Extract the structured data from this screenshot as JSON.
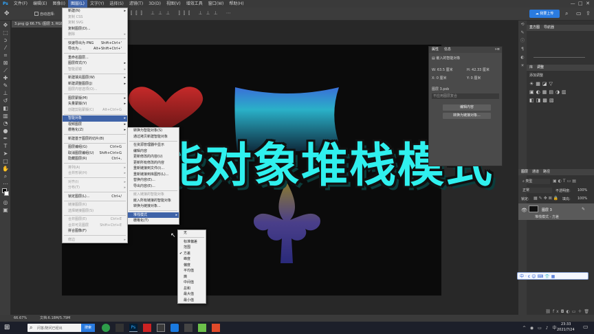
{
  "menubar": {
    "items": [
      "文件(F)",
      "编辑(E)",
      "图像(I)",
      "图层(L)",
      "文字(Y)",
      "选择(S)",
      "滤镜(T)",
      "3D(D)",
      "视图(V)",
      "增效工具",
      "窗口(W)",
      "帮助(H)"
    ]
  },
  "options": {
    "auto_select": "自动选择:",
    "upload_btn": "我要上传"
  },
  "doc_tab": {
    "title": "3.png @ 66.7% (图层 3, RGB/8#) ×"
  },
  "layer_menu": {
    "items": [
      {
        "label": "新建(N)",
        "arrow": true
      },
      {
        "label": "复制 CSS",
        "disabled": true
      },
      {
        "label": "复制 SVG",
        "disabled": true
      },
      {
        "label": "复制图层(D)..."
      },
      {
        "label": "删除",
        "arrow": true,
        "disabled": true
      },
      {
        "sep": true
      },
      {
        "label": "快速导出为 PNG",
        "shortcut": "Shift+Ctrl+'"
      },
      {
        "label": "导出为...",
        "shortcut": "Alt+Shift+Ctrl+'"
      },
      {
        "sep": true
      },
      {
        "label": "重命名图层..."
      },
      {
        "label": "图层样式(Y)",
        "arrow": true
      },
      {
        "label": "智能滤镜",
        "arrow": true,
        "disabled": true
      },
      {
        "sep": true
      },
      {
        "label": "新建填充图层(W)",
        "arrow": true
      },
      {
        "label": "新建调整图层(J)",
        "arrow": true
      },
      {
        "label": "图层内容选项(O)...",
        "disabled": true
      },
      {
        "sep": true
      },
      {
        "label": "图层蒙版(M)",
        "arrow": true
      },
      {
        "label": "矢量蒙版(V)",
        "arrow": true
      },
      {
        "label": "创建剪贴蒙版(C)",
        "shortcut": "Alt+Ctrl+G",
        "disabled": true
      },
      {
        "sep": true
      },
      {
        "label": "智能对象",
        "arrow": true,
        "highlight": true
      },
      {
        "label": "视频图层",
        "arrow": true
      },
      {
        "label": "栅格化(Z)",
        "arrow": true
      },
      {
        "sep": true
      },
      {
        "label": "新建基于图层的切片(B)"
      },
      {
        "sep": true
      },
      {
        "label": "图层编组(G)",
        "shortcut": "Ctrl+G"
      },
      {
        "label": "取消图层编组(U)",
        "shortcut": "Shift+Ctrl+G"
      },
      {
        "label": "隐藏图层(R)",
        "shortcut": "Ctrl+,"
      },
      {
        "sep": true
      },
      {
        "label": "排列(A)",
        "arrow": true,
        "disabled": true
      },
      {
        "label": "合并形状(H)",
        "arrow": true,
        "disabled": true
      },
      {
        "sep": true
      },
      {
        "label": "对齐(I)",
        "arrow": true,
        "disabled": true
      },
      {
        "label": "分布(T)",
        "arrow": true,
        "disabled": true
      },
      {
        "sep": true
      },
      {
        "label": "锁定图层(L)...",
        "shortcut": "Ctrl+/"
      },
      {
        "sep": true
      },
      {
        "label": "链接图层(K)",
        "disabled": true
      },
      {
        "label": "选择链接图层(S)",
        "disabled": true
      },
      {
        "sep": true
      },
      {
        "label": "合并图层(E)",
        "shortcut": "Ctrl+E",
        "disabled": true
      },
      {
        "label": "合并可见图层",
        "shortcut": "Shift+Ctrl+E",
        "disabled": true
      },
      {
        "label": "拼合图像(F)"
      },
      {
        "sep": true
      },
      {
        "label": "修边",
        "arrow": true,
        "disabled": true
      }
    ]
  },
  "smart_menu": {
    "items": [
      {
        "label": "转换为智能对象(S)"
      },
      {
        "label": "通过拷贝新建智能对象"
      },
      {
        "sep": true
      },
      {
        "label": "在资源管理器中显示"
      },
      {
        "label": "编辑内容"
      },
      {
        "label": "更新修改的内容(U)"
      },
      {
        "label": "更新所有修改的内容"
      },
      {
        "label": "重新链接到文件(I)..."
      },
      {
        "label": "重新链接到库图形(L)..."
      },
      {
        "label": "替换内容(E)..."
      },
      {
        "label": "导出内容(E)..."
      },
      {
        "sep": true
      },
      {
        "label": "嵌入链接的智能对象",
        "disabled": true
      },
      {
        "label": "嵌入所有链接的智能对象"
      },
      {
        "label": "转换为链接对象..."
      },
      {
        "sep": true
      },
      {
        "label": "堆栈模式",
        "arrow": true,
        "highlight": true
      },
      {
        "label": "栅格化(T)"
      }
    ]
  },
  "stack_menu": {
    "items": [
      {
        "label": "无"
      },
      {
        "sep": true
      },
      {
        "label": "标准偏差"
      },
      {
        "label": "范围"
      },
      {
        "label": "方差",
        "checked": true
      },
      {
        "label": "峰度"
      },
      {
        "label": "偏度"
      },
      {
        "label": "平均值"
      },
      {
        "label": "熵"
      },
      {
        "label": "中间值"
      },
      {
        "label": "总和"
      },
      {
        "label": "最大值"
      },
      {
        "label": "最小值"
      }
    ]
  },
  "overlay_title": "智能对象堆栈模式",
  "properties_panel": {
    "tabs": [
      "属性",
      "信息"
    ],
    "subtitle": "嵌入的智能对象",
    "w": "W: 63.5 厘米",
    "h": "H: 42.33 厘米",
    "x": "X: 0 厘米",
    "y": "Y: 0 厘米",
    "layer_file": "图层 3.psb",
    "comp": "不应用图层复合",
    "edit_btn": "编辑内容",
    "convert_btn": "转换为链接对象..."
  },
  "right_dock": {
    "nav_tabs": [
      "直方图",
      "导航器"
    ],
    "lib_tabs": [
      "库",
      "调整"
    ],
    "adj_title": "添加调整",
    "layers_tabs": [
      "图层",
      "通道",
      "路径"
    ],
    "kind": "类型",
    "blend": "正常",
    "opacity_label": "不透明度:",
    "opacity": "100%",
    "lock_label": "锁定:",
    "fill_label": "填充:",
    "fill": "100%",
    "layer_name": "图层 3",
    "layer_sub": "堆栈模式 - 方差"
  },
  "status": {
    "zoom": "66.67%",
    "doc": "文档:6.18M/5.79M"
  },
  "taskbar": {
    "search_placeholder": "问答/随问已经出",
    "search_btn": "搜索",
    "time": "23:33",
    "date": "2021/7/24"
  }
}
